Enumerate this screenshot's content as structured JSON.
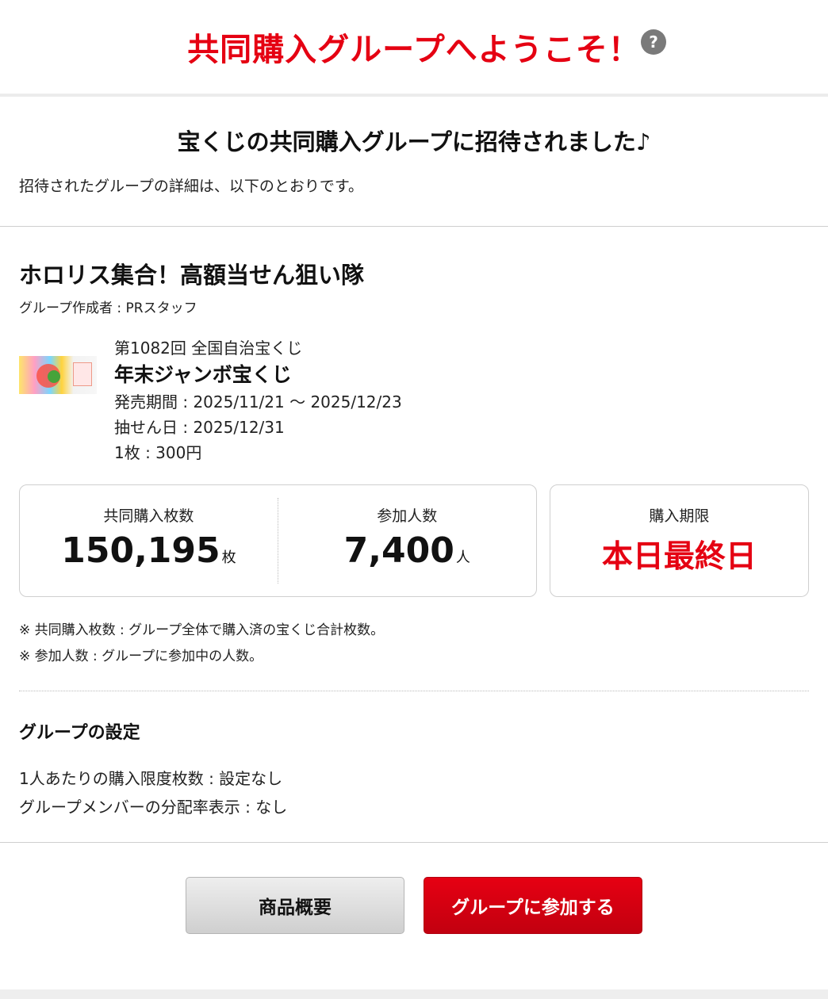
{
  "header": {
    "title": "共同購入グループへようこそ！",
    "help_icon": "?"
  },
  "invite": {
    "heading": "宝くじの共同購入グループに招待されました♪",
    "description": "招待されたグループの詳細は、以下のとおりです。"
  },
  "group": {
    "name": "ホロリス集合！高額当せん狙い隊",
    "creator": "グループ作成者 : PRスタッフ"
  },
  "lottery": {
    "round": "第1082回 全国自治宝くじ",
    "name": "年末ジャンボ宝くじ",
    "sale_period": "発売期間 : 2025/11/21 ～ 2025/12/23",
    "draw_date": "抽せん日 : 2025/12/31",
    "price": "1枚 : 300円"
  },
  "stats": {
    "tickets_label": "共同購入枚数",
    "tickets_value": "150,195",
    "tickets_unit": "枚",
    "members_label": "参加人数",
    "members_value": "7,400",
    "members_unit": "人",
    "deadline_label": "購入期限",
    "deadline_value": "本日最終日"
  },
  "notes": [
    "※ 共同購入枚数 : グループ全体で購入済の宝くじ合計枚数。",
    "※ 参加人数 : グループに参加中の人数。"
  ],
  "settings": {
    "heading": "グループの設定",
    "limit": "1人あたりの購入限度枚数 : 設定なし",
    "distribution": "グループメンバーの分配率表示 : なし"
  },
  "buttons": {
    "overview": "商品概要",
    "join": "グループに参加する"
  },
  "colors": {
    "accent_red": "#e50012",
    "border_gray": "#cfcfcf"
  }
}
